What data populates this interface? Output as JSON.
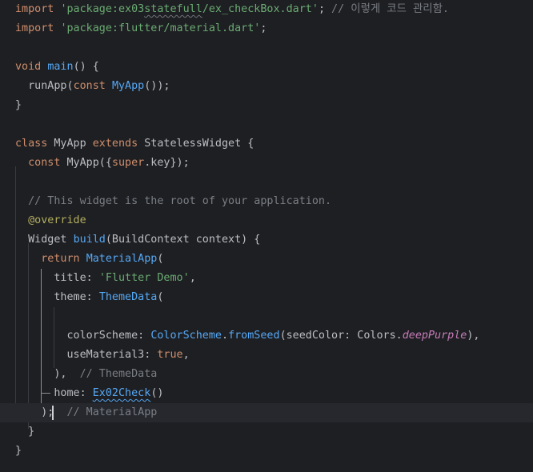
{
  "lines": [
    {
      "segments": [
        {
          "t": "import ",
          "c": "kw"
        },
        {
          "t": "'package:ex03",
          "c": "str"
        },
        {
          "t": "statefull",
          "c": "str squiggle"
        },
        {
          "t": "/ex_checkBox.dart'",
          "c": "str"
        },
        {
          "t": ";",
          "c": ""
        },
        {
          "t": " // 이렇게 코드 관리함.",
          "c": "cmt"
        }
      ]
    },
    {
      "segments": [
        {
          "t": "import ",
          "c": "kw"
        },
        {
          "t": "'package:flutter/material.dart'",
          "c": "str"
        },
        {
          "t": ";",
          "c": ""
        }
      ]
    },
    {
      "segments": []
    },
    {
      "segments": [
        {
          "t": "void ",
          "c": "kw"
        },
        {
          "t": "main",
          "c": "fn"
        },
        {
          "t": "() {",
          "c": ""
        }
      ]
    },
    {
      "segments": [
        {
          "t": "  runApp(",
          "c": ""
        },
        {
          "t": "const ",
          "c": "kw"
        },
        {
          "t": "MyApp",
          "c": "typ"
        },
        {
          "t": "());",
          "c": ""
        }
      ]
    },
    {
      "segments": [
        {
          "t": "}",
          "c": ""
        }
      ]
    },
    {
      "segments": []
    },
    {
      "segments": [
        {
          "t": "class ",
          "c": "kw"
        },
        {
          "t": "MyApp ",
          "c": ""
        },
        {
          "t": "extends ",
          "c": "kw"
        },
        {
          "t": "StatelessWidget {",
          "c": ""
        }
      ]
    },
    {
      "segments": [
        {
          "t": "  ",
          "c": ""
        },
        {
          "t": "const ",
          "c": "kw"
        },
        {
          "t": "MyApp({",
          "c": ""
        },
        {
          "t": "super",
          "c": "kw"
        },
        {
          "t": ".key});",
          "c": ""
        }
      ]
    },
    {
      "segments": []
    },
    {
      "segments": [
        {
          "t": "  // This widget is the root of your application.",
          "c": "cmt"
        }
      ]
    },
    {
      "segments": [
        {
          "t": "  ",
          "c": ""
        },
        {
          "t": "@override",
          "c": "ann"
        }
      ]
    },
    {
      "segments": [
        {
          "t": "  Widget ",
          "c": ""
        },
        {
          "t": "build",
          "c": "fn"
        },
        {
          "t": "(BuildContext context) {",
          "c": ""
        }
      ]
    },
    {
      "segments": [
        {
          "t": "    ",
          "c": ""
        },
        {
          "t": "return ",
          "c": "kw"
        },
        {
          "t": "MaterialApp",
          "c": "typ"
        },
        {
          "t": "(",
          "c": ""
        }
      ]
    },
    {
      "segments": [
        {
          "t": "      title: ",
          "c": ""
        },
        {
          "t": "'Flutter Demo'",
          "c": "str"
        },
        {
          "t": ",",
          "c": ""
        }
      ]
    },
    {
      "segments": [
        {
          "t": "      theme: ",
          "c": ""
        },
        {
          "t": "ThemeData",
          "c": "typ"
        },
        {
          "t": "(",
          "c": ""
        }
      ]
    },
    {
      "segments": []
    },
    {
      "segments": [
        {
          "t": "        colorScheme: ",
          "c": ""
        },
        {
          "t": "ColorScheme",
          "c": "typ"
        },
        {
          "t": ".",
          "c": ""
        },
        {
          "t": "fromSeed",
          "c": "fn"
        },
        {
          "t": "(seedColor: Colors.",
          "c": ""
        },
        {
          "t": "deepPurple",
          "c": "italic-purple"
        },
        {
          "t": "),",
          "c": ""
        }
      ]
    },
    {
      "segments": [
        {
          "t": "        useMaterial3: ",
          "c": ""
        },
        {
          "t": "true",
          "c": "kw"
        },
        {
          "t": ",",
          "c": ""
        }
      ]
    },
    {
      "segments": [
        {
          "t": "      ),  ",
          "c": ""
        },
        {
          "t": "// ThemeData",
          "c": "cmt"
        }
      ]
    },
    {
      "segments": [
        {
          "t": "      home: ",
          "c": ""
        },
        {
          "t": "Ex02Check",
          "c": "typ squiggle-blue"
        },
        {
          "t": "()",
          "c": ""
        }
      ]
    },
    {
      "segments": [
        {
          "t": "    );  ",
          "c": ""
        },
        {
          "t": "// MaterialApp",
          "c": "cmt"
        }
      ]
    },
    {
      "segments": [
        {
          "t": "  }",
          "c": ""
        }
      ]
    },
    {
      "segments": [
        {
          "t": "}",
          "c": ""
        }
      ]
    }
  ]
}
